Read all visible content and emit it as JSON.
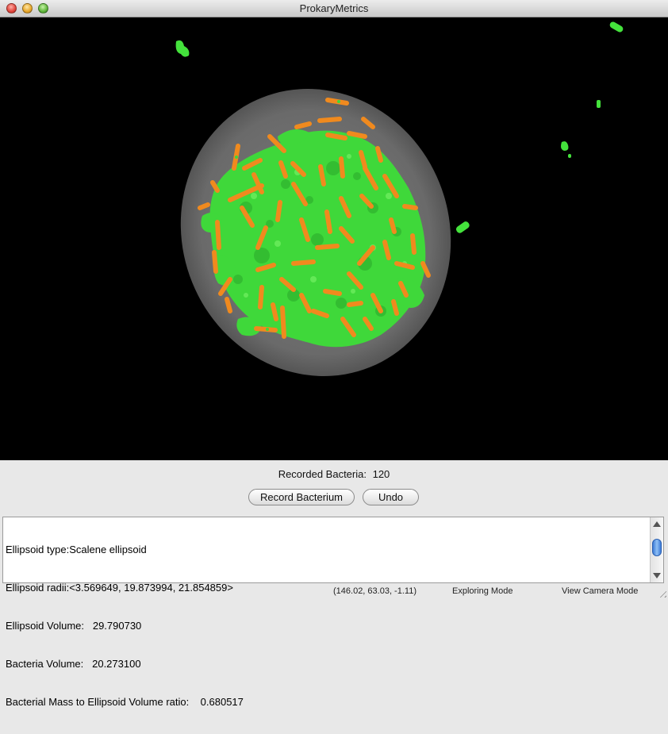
{
  "window": {
    "title": "ProkaryMetrics"
  },
  "controls": {
    "recorded_label": "Recorded Bacteria:",
    "recorded_count": "120",
    "record_button": "Record Bacterium",
    "undo_button": "Undo"
  },
  "info": {
    "lines": [
      "Ellipsoid type:Scalene ellipsoid",
      "Ellipsoid radii:<3.569649, 19.873994, 21.854859>",
      "Ellipsoid Volume:   29.790730",
      "Bacteria Volume:   20.273100",
      "Bacterial Mass to Ellipsoid Volume ratio:    0.680517"
    ]
  },
  "status": {
    "coords": "(146.02, 63.03, -1.11)",
    "mode": "Exploring Mode",
    "camera": "View Camera Mode"
  },
  "colors": {
    "bacteria_green": "#44e23c",
    "rod_orange": "#f08a1e",
    "ellipsoid_gray": "#6e6e6e"
  }
}
